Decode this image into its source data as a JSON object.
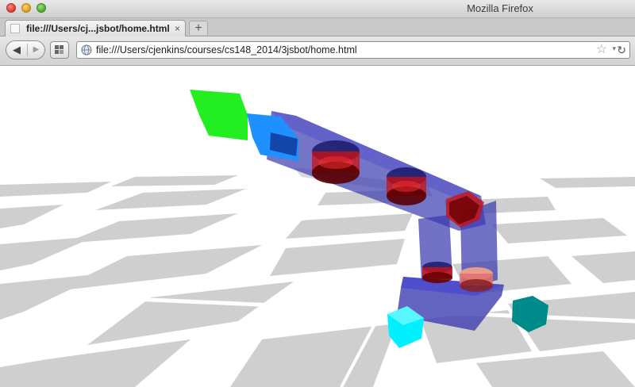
{
  "window": {
    "title": "Mozilla Firefox"
  },
  "tabs": [
    {
      "title": "file:///Users/cj...jsbot/home.html",
      "close": "×"
    }
  ],
  "new_tab_label": "+",
  "nav": {
    "back": "◀",
    "forward": "▶"
  },
  "urlbar": {
    "url": "file:///Users/cjenkins/courses/cs148_2014/3jsbot/home.html"
  },
  "icons": {
    "close": "close-traffic-light",
    "minimize": "minimize-traffic-light",
    "maximize": "maximize-traffic-light",
    "back": "back-arrow-icon",
    "forward": "forward-arrow-icon",
    "tab_view": "tab-groups-icon",
    "site": "globe-icon",
    "bookmark": "star-icon",
    "history": "dropmark-icon",
    "reload": "reload-icon"
  },
  "glyphs": {
    "star": "☆",
    "dropmark": "▾",
    "reload": "↻"
  },
  "colors": {
    "green_target": "#22ee22",
    "blue_target": "#1e90ff",
    "cyan_cube": "#00f0ff",
    "teal_hexagon": "#008b8b",
    "robot_link": "#3a3ab0",
    "robot_joint": "#cc1010",
    "floor_dark": "#cdcdcd",
    "floor_light": "#ffffff"
  }
}
